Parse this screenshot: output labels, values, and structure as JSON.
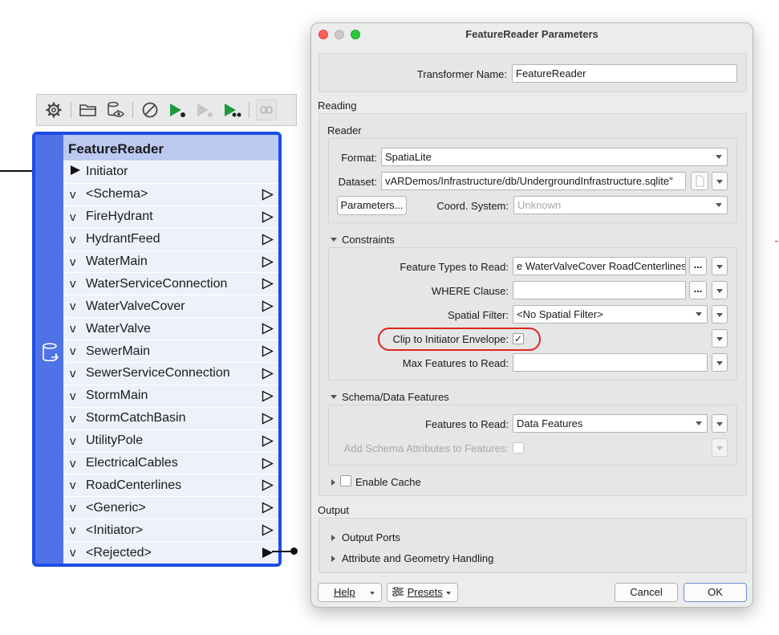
{
  "canvas": {
    "node": {
      "title": "FeatureReader",
      "initiator_port": "Initiator",
      "output_ports": [
        "<Schema>",
        "FireHydrant",
        "HydrantFeed",
        "WaterMain",
        "WaterServiceConnection",
        "WaterValveCover",
        "WaterValve",
        "SewerMain",
        "SewerServiceConnection",
        "StormMain",
        "StormCatchBasin",
        "UtilityPole",
        "ElectricalCables",
        "RoadCenterlines",
        "<Generic>",
        "<Initiator>",
        "<Rejected>"
      ],
      "chevron": "v"
    },
    "toolbar": {
      "icons": [
        "gear-icon",
        "folder-open-icon",
        "database-view-icon",
        "disable-icon",
        "run-to-this-icon",
        "run-from-this-icon",
        "run-partial-icon",
        "feature-cache-icon"
      ]
    }
  },
  "dialog": {
    "title": "FeatureReader Parameters",
    "transformer_name_label": "Transformer Name:",
    "transformer_name_value": "FeatureReader",
    "reading_label": "Reading",
    "reader_label": "Reader",
    "format_label": "Format:",
    "format_value": "SpatiaLite",
    "dataset_label": "Dataset:",
    "dataset_value": "vARDemos/Infrastructure/db/UndergroundInfrastructure.sqlite\"",
    "parameters_button": "Parameters...",
    "coord_system_label": "Coord. System:",
    "coord_system_value": "Unknown",
    "constraints_label": "Constraints",
    "feature_types_label": "Feature Types to Read:",
    "feature_types_value": "e WaterValveCover RoadCenterlines",
    "where_clause_label": "WHERE Clause:",
    "where_clause_value": "",
    "spatial_filter_label": "Spatial Filter:",
    "spatial_filter_value": "<No Spatial Filter>",
    "clip_label": "Clip to Initiator Envelope:",
    "clip_checked": "✓",
    "max_features_label": "Max Features to Read:",
    "max_features_value": "",
    "schema_data_label": "Schema/Data Features",
    "features_to_read_label": "Features to Read:",
    "features_to_read_value": "Data Features",
    "add_schema_attrs_label": "Add Schema Attributes to Features:",
    "enable_cache_label": "Enable Cache",
    "output_label": "Output",
    "output_ports_label": "Output Ports",
    "attr_geom_label": "Attribute and Geometry Handling",
    "dots": "...",
    "help_button": "Help",
    "presets_button": "Presets",
    "cancel_button": "Cancel",
    "ok_button": "OK"
  },
  "colors": {
    "node_border": "#1d4de4",
    "node_header": "#bccaf2",
    "highlight": "#e0241f"
  }
}
